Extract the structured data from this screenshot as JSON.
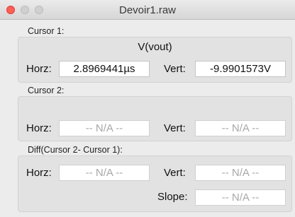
{
  "window": {
    "title": "Devoir1.raw"
  },
  "cursor1": {
    "label": "Cursor 1:",
    "signal": "V(vout)",
    "horz_label": "Horz:",
    "horz_value": "2.8969441µs",
    "vert_label": "Vert:",
    "vert_value": "-9.9901573V"
  },
  "cursor2": {
    "label": "Cursor 2:",
    "horz_label": "Horz:",
    "horz_value": "-- N/A --",
    "vert_label": "Vert:",
    "vert_value": "-- N/A --"
  },
  "diff": {
    "label": "Diff(Cursor 2- Cursor 1):",
    "horz_label": "Horz:",
    "horz_value": "-- N/A --",
    "vert_label": "Vert:",
    "vert_value": "-- N/A --",
    "slope_label": "Slope:",
    "slope_value": "-- N/A --"
  },
  "colors": {
    "close_button": "#fc5f57",
    "placeholder_text": "#a8a8a8"
  }
}
